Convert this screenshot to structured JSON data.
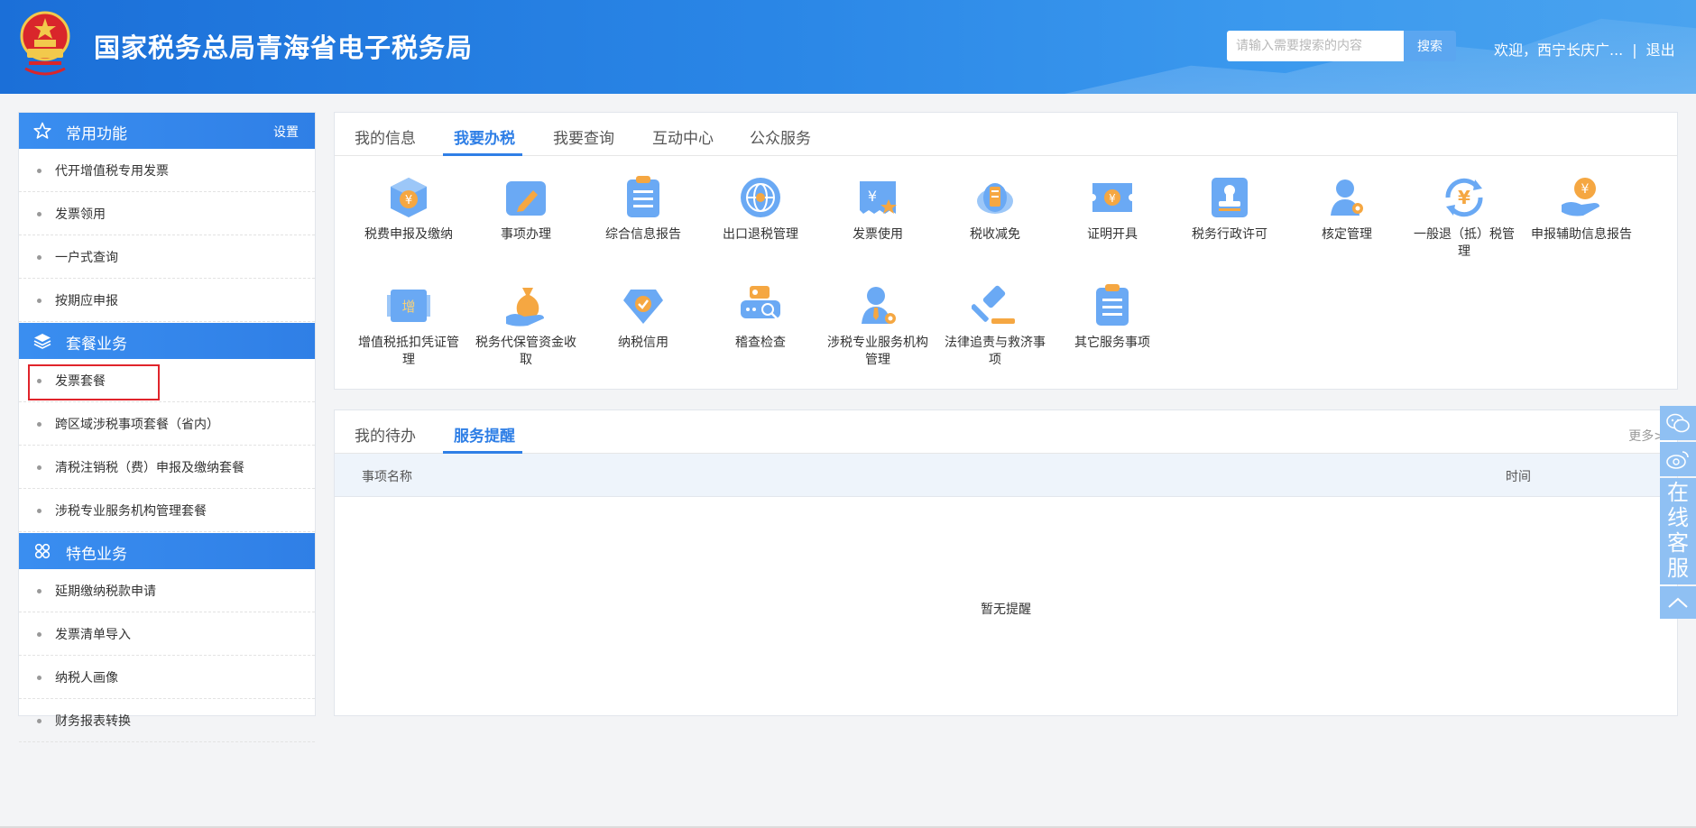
{
  "header": {
    "title": "国家税务总局青海省电子税务局",
    "search_placeholder": "请输入需要搜索的内容",
    "search_button": "搜索",
    "welcome": "欢迎，西宁长庆广...",
    "separator": "|",
    "logout": "退出"
  },
  "sidebar": {
    "section_common": {
      "label": "常用功能",
      "setting": "设置"
    },
    "common_items": [
      "代开增值税专用发票",
      "发票领用",
      "一户式查询",
      "按期应申报"
    ],
    "section_package": {
      "label": "套餐业务"
    },
    "package_items": [
      "发票套餐",
      "跨区域涉税事项套餐（省内）",
      "清税注销税（费）申报及缴纳套餐",
      "涉税专业服务机构管理套餐"
    ],
    "section_special": {
      "label": "特色业务"
    },
    "special_items": [
      "延期缴纳税款申请",
      "发票清单导入",
      "纳税人画像",
      "财务报表转换"
    ]
  },
  "main_tabs": {
    "tabs": [
      "我的信息",
      "我要办税",
      "我要查询",
      "互动中心",
      "公众服务"
    ],
    "active": "我要办税"
  },
  "functions": [
    {
      "label": "税费申报及缴纳",
      "icon": "tax-payment-icon"
    },
    {
      "label": "事项办理",
      "icon": "edit-icon"
    },
    {
      "label": "综合信息报告",
      "icon": "report-icon"
    },
    {
      "label": "出口退税管理",
      "icon": "globe-icon"
    },
    {
      "label": "发票使用",
      "icon": "invoice-icon"
    },
    {
      "label": "税收减免",
      "icon": "tax-relief-icon"
    },
    {
      "label": "证明开具",
      "icon": "certificate-icon"
    },
    {
      "label": "税务行政许可",
      "icon": "stamp-icon"
    },
    {
      "label": "核定管理",
      "icon": "person-gear-icon"
    },
    {
      "label": "一般退（抵）税管理",
      "icon": "refund-icon"
    },
    {
      "label": "申报辅助信息报告",
      "icon": "hand-coin-icon"
    },
    {
      "label": "增值税抵扣凭证管理",
      "icon": "vat-ticket-icon"
    },
    {
      "label": "税务代保管资金收取",
      "icon": "money-bag-icon"
    },
    {
      "label": "纳税信用",
      "icon": "diamond-check-icon"
    },
    {
      "label": "稽查检查",
      "icon": "inspection-icon"
    },
    {
      "label": "涉税专业服务机构管理",
      "icon": "agent-icon"
    },
    {
      "label": "法律追责与救济事项",
      "icon": "gavel-icon"
    },
    {
      "label": "其它服务事项",
      "icon": "list-icon"
    }
  ],
  "service_panel": {
    "tabs": [
      "我的待办",
      "服务提醒"
    ],
    "active": "服务提醒",
    "more": "更多>",
    "columns": [
      "事项名称",
      "时间"
    ],
    "empty_text": "暂无提醒"
  },
  "float": {
    "service_text": "在线客服"
  },
  "colors": {
    "brand_blue": "#2f7fe6",
    "header_blue": "#1b6fd8",
    "highlight_red": "#e0242b"
  }
}
